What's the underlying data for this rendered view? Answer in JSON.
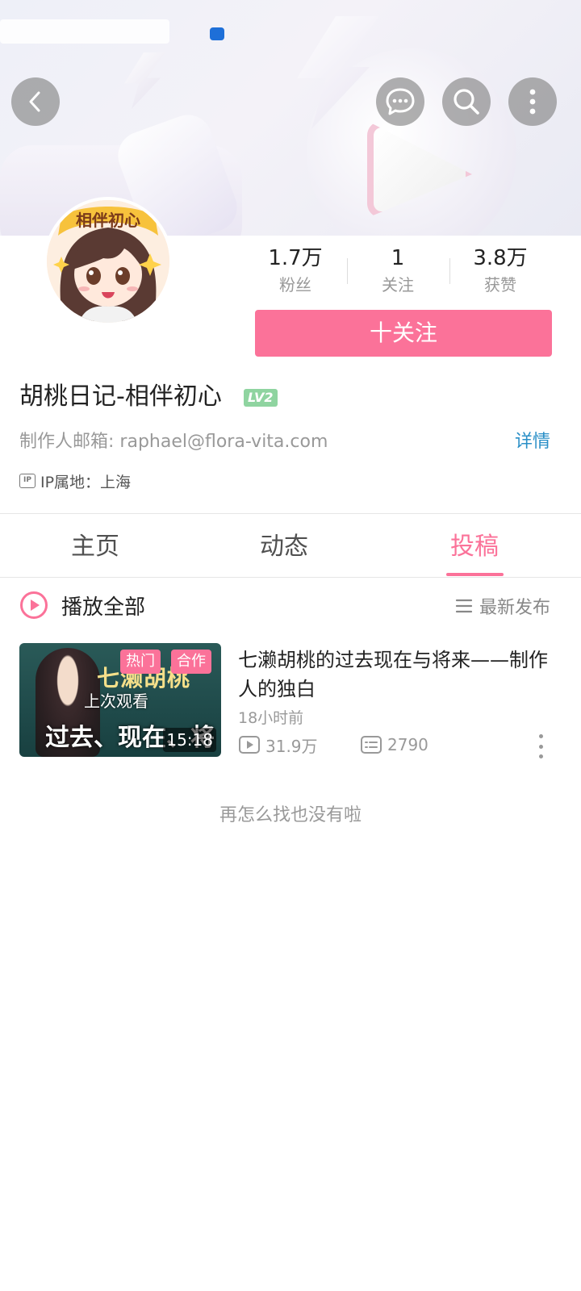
{
  "header": {
    "back_icon": "chevron-left-icon",
    "message_icon": "chat-bubble-icon",
    "search_icon": "search-icon",
    "more_icon": "more-vertical-icon"
  },
  "profile": {
    "avatar_text": "相伴初心",
    "name": "胡桃日记-相伴初心",
    "level_badge": "LV2",
    "email_label": "制作人邮箱:",
    "email": "raphael@flora-vita.com",
    "details_label": "详情",
    "ip_icon_text": "IP",
    "ip_location": "IP属地：上海",
    "follow_button": "十关注",
    "stats": [
      {
        "value": "1.7万",
        "label": "粉丝"
      },
      {
        "value": "1",
        "label": "关注"
      },
      {
        "value": "3.8万",
        "label": "获赞"
      }
    ]
  },
  "tabs": [
    {
      "label": "主页",
      "active": false
    },
    {
      "label": "动态",
      "active": false
    },
    {
      "label": "投稿",
      "active": true
    }
  ],
  "list_header": {
    "play_all": "播放全部",
    "sort": "最新发布"
  },
  "video": {
    "thumb_title_top": "七濑胡桃",
    "thumb_title_bottom": "过去、现在、将来",
    "tags": [
      "热门",
      "合作"
    ],
    "last_watched": "上次观看",
    "duration": "15:18",
    "title": "七濑胡桃的过去现在与将来——制作人的独白",
    "time": "18小时前",
    "views": "31.9万",
    "comments": "2790"
  },
  "footer_text": "再怎么找也没有啦",
  "colors": {
    "accent": "#fb7299",
    "link": "#2a8fc7",
    "muted": "#999999"
  }
}
